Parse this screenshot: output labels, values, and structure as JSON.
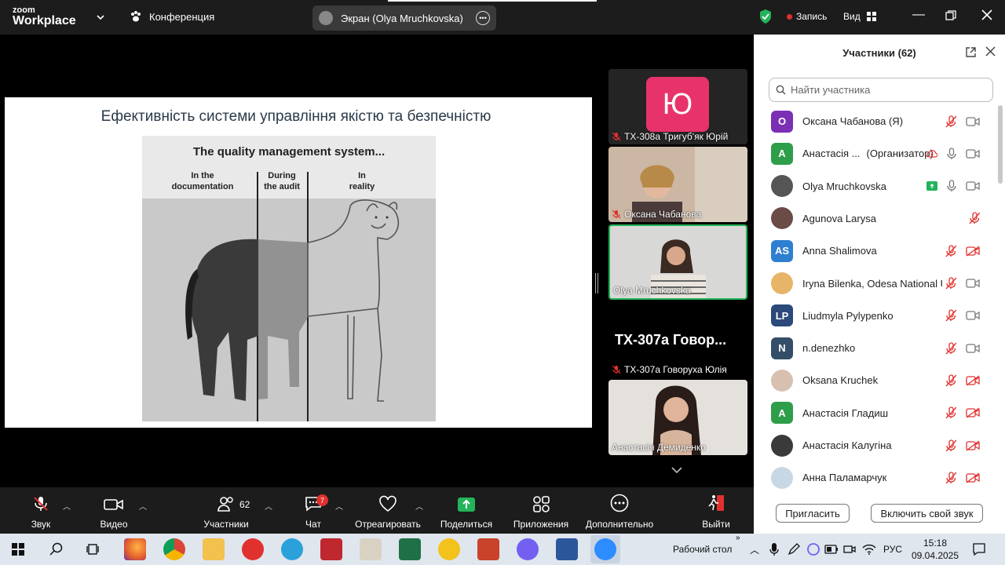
{
  "topbar": {
    "logo_line1": "zoom",
    "logo_line2": "Workplace",
    "conference_label": "Конференция",
    "screen_label": "Экран (Olya Mruchkovska)",
    "record_label": "Запись",
    "view_label": "Вид"
  },
  "slide": {
    "title": "Ефективність системи управління якістю та безпечністю",
    "meme_title": "The quality management system...",
    "col1_line1": "In the",
    "col1_line2": "documentation",
    "col2_line1": "During",
    "col2_line2": "the audit",
    "col3_line1": "In",
    "col3_line2": "reality"
  },
  "tiles": [
    {
      "avatar": "Ю",
      "name": "ТХ-308а Тригуб'як Юрій",
      "muted": true
    },
    {
      "name": "Оксана Чабанова",
      "muted": true
    },
    {
      "name": "Olya Mruchkovska",
      "muted": false,
      "active": true
    },
    {
      "big_text": "ТХ-307а  Говор...",
      "name": "ТХ-307а Говоруха Юлія",
      "muted": true
    },
    {
      "name": "Анастасія Демиденко",
      "muted": false
    }
  ],
  "panel": {
    "title": "Участники (62)",
    "search_placeholder": "Найти участника",
    "invite_label": "Пригласить",
    "unmute_label": "Включить свой звук",
    "participants": [
      {
        "avatar": "O",
        "color": "#7b2fb5",
        "name": "Оксана Чабанова (Я)",
        "mic": "off-red",
        "cam": "on"
      },
      {
        "avatar": "A",
        "color": "#2e9e4a",
        "name": "Анастасія ...",
        "role": "(Организатор)",
        "mic": "on",
        "cam": "on",
        "rec": true
      },
      {
        "avatar": "",
        "color": "#555",
        "name": "Olya Mruchkovska",
        "mic": "on",
        "cam": "on",
        "share": true
      },
      {
        "avatar": "",
        "color": "#6b4b45",
        "name": "Agunova Larysa",
        "mic": "off-red",
        "cam": "none"
      },
      {
        "avatar": "AS",
        "color": "#2f7fd1",
        "name": "Anna Shalimova",
        "mic": "off-red",
        "cam": "off-red"
      },
      {
        "avatar": "",
        "color": "#e7b468",
        "name": "Iryna Bilenka, Odesa National U...",
        "mic": "off-red",
        "cam": "on"
      },
      {
        "avatar": "LP",
        "color": "#2b4a7a",
        "name": "Liudmyla Pylypenko",
        "mic": "off-red",
        "cam": "on"
      },
      {
        "avatar": "N",
        "color": "#334e68",
        "name": "n.denezhko",
        "mic": "off-red",
        "cam": "on"
      },
      {
        "avatar": "",
        "color": "#d8c0b0",
        "name": "Oksana Kruchek",
        "mic": "off-red",
        "cam": "off-red"
      },
      {
        "avatar": "A",
        "color": "#2e9e4a",
        "name": "Анастасія Гладиш",
        "mic": "off-red",
        "cam": "off-red"
      },
      {
        "avatar": "",
        "color": "#3a3a3a",
        "name": "Анастасія Калугіна",
        "mic": "off-red",
        "cam": "off-red"
      },
      {
        "avatar": "",
        "color": "#c7d7e4",
        "name": "Анна Паламарчук",
        "mic": "off-red",
        "cam": "off-red"
      }
    ]
  },
  "toolbar": {
    "sound": "Звук",
    "video": "Видео",
    "participants": "Участники",
    "participants_count": "62",
    "chat": "Чат",
    "chat_badge": "7",
    "react": "Отреагировать",
    "share": "Поделиться",
    "apps": "Приложения",
    "more": "Дополнительно",
    "leave": "Выйти"
  },
  "taskbar": {
    "desktop_label": "Рабочий стол",
    "lang": "РУС",
    "time": "15:18",
    "date": "09.04.2025"
  },
  "colors": {
    "accent_green": "#23b45a",
    "muted_red": "#e0312f",
    "avatar_pink": "#e8336a"
  }
}
